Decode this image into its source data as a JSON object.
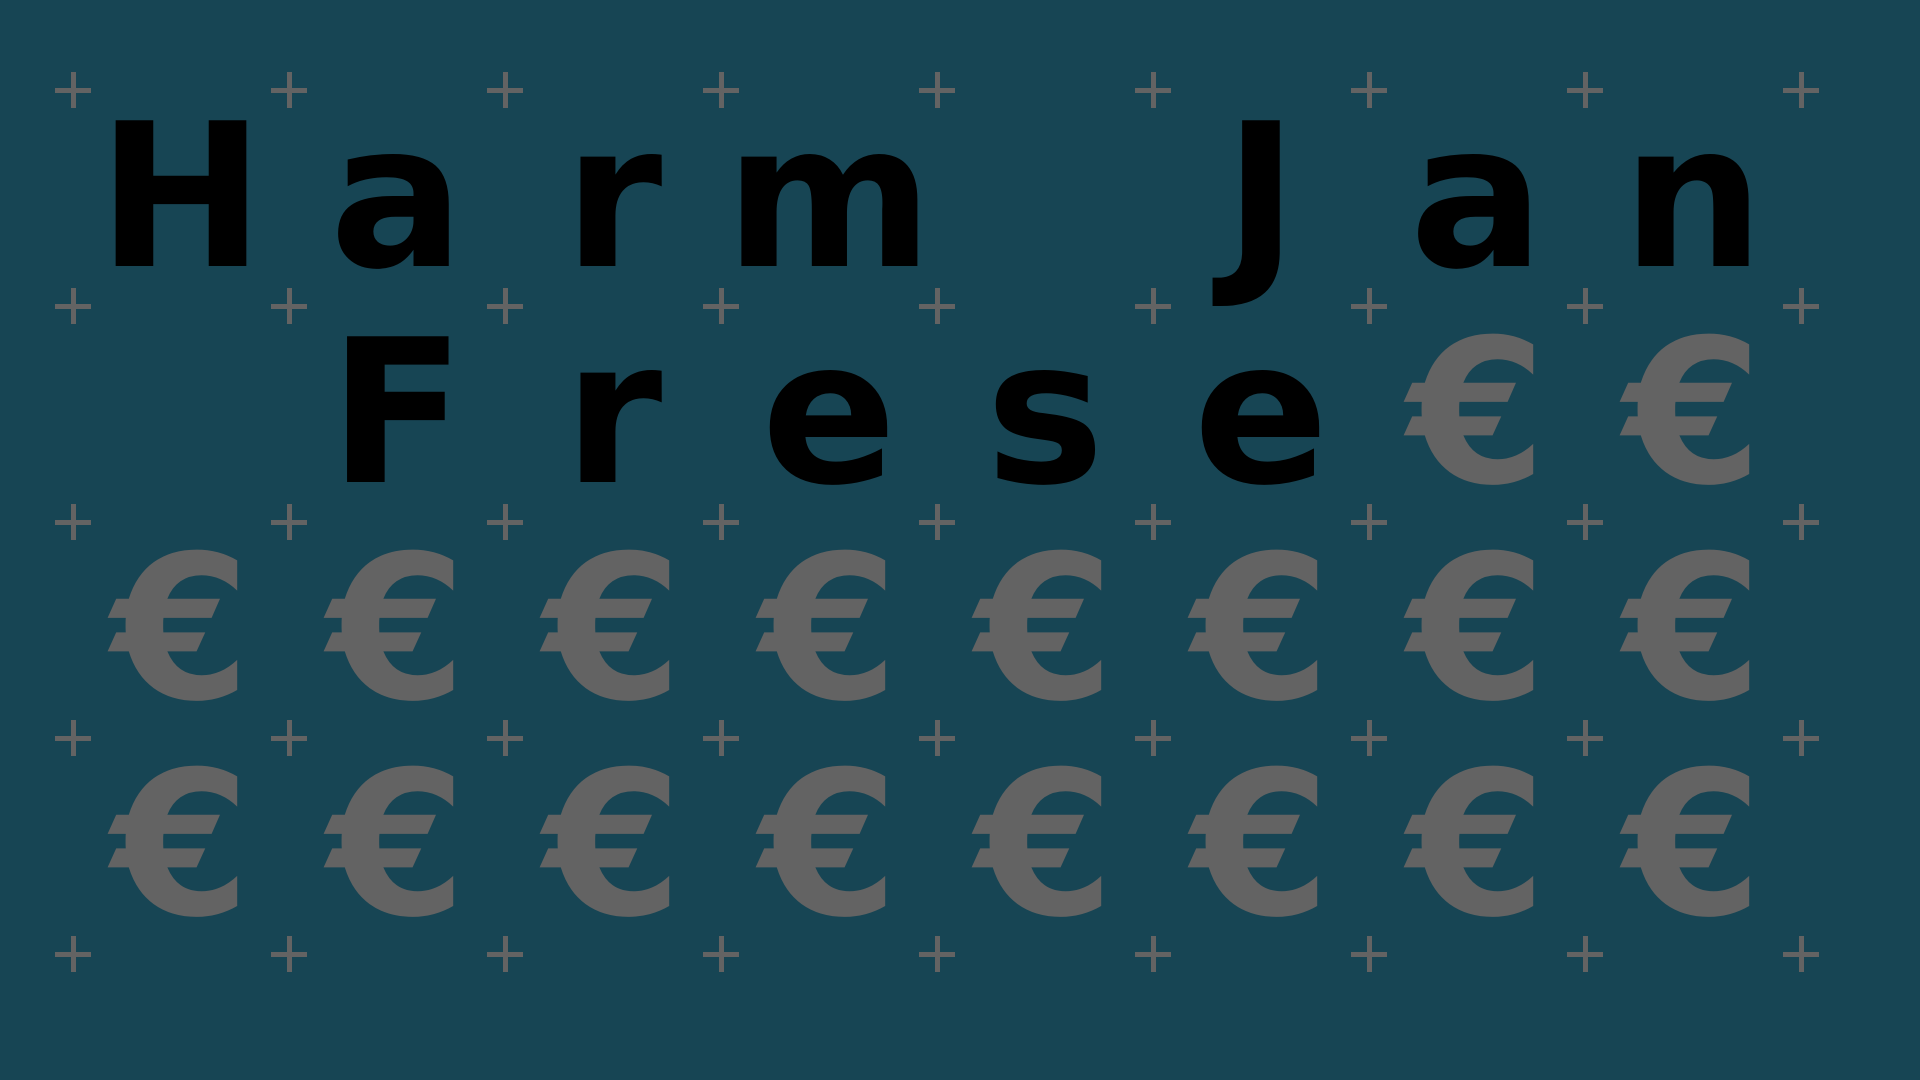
{
  "name_grid": {
    "rows": [
      [
        "H",
        "a",
        "r",
        "m",
        "",
        "J",
        "a",
        "n"
      ],
      [
        "",
        "F",
        "r",
        "e",
        "s",
        "e",
        "€",
        "€"
      ],
      [
        "€",
        "€",
        "€",
        "€",
        "€",
        "€",
        "€",
        "€"
      ],
      [
        "€",
        "€",
        "€",
        "€",
        "€",
        "€",
        "€",
        "€"
      ]
    ]
  },
  "colors": {
    "background": "#174554",
    "letter": "#000000",
    "euro": "#636363",
    "plus_marker": "#636363"
  }
}
